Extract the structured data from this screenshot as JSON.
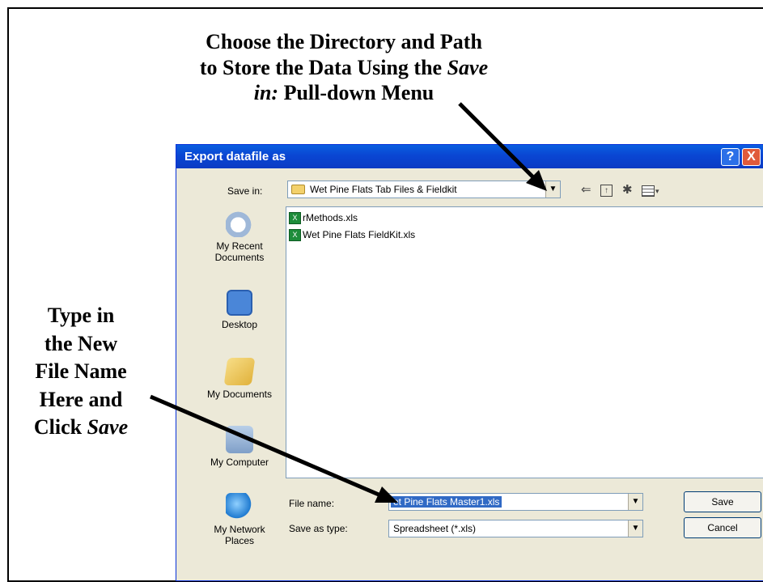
{
  "annotations": {
    "top_line1": "Choose the Directory and Path",
    "top_line2a": "to Store the Data Using the ",
    "top_line2b": "Save",
    "top_line3a": "in:",
    "top_line3b": " Pull-down Menu",
    "left_line1": "Type in",
    "left_line2": "the New",
    "left_line3": "File Name",
    "left_line4": "Here and",
    "left_line5a": "Click ",
    "left_line5b": "Save"
  },
  "dialog": {
    "title": "Export datafile as",
    "help_label": "?",
    "close_label": "X",
    "save_in_label": "Save in:",
    "save_in_value": "Wet Pine Flats Tab Files & Fieldkit",
    "icons": [
      "back-icon",
      "up-folder-icon",
      "new-folder-icon",
      "views-menu-icon"
    ],
    "places": [
      {
        "label_line1": "My Recent",
        "label_line2": "Documents"
      },
      {
        "label_line1": "Desktop",
        "label_line2": ""
      },
      {
        "label_line1": "My Documents",
        "label_line2": ""
      },
      {
        "label_line1": "My Computer",
        "label_line2": ""
      },
      {
        "label_line1": "My Network",
        "label_line2": "Places"
      }
    ],
    "files": [
      "rMethods.xls",
      "Wet Pine Flats FieldKit.xls"
    ],
    "file_name_label": "File name:",
    "file_name_value": "et Pine Flats Master1.xls",
    "save_as_type_label": "Save as type:",
    "save_as_type_value": "Spreadsheet (*.xls)",
    "save_button": "Save",
    "cancel_button": "Cancel"
  },
  "colors": {
    "titlebar": "#0a46d3",
    "dialog_bg": "#ece9d8",
    "selection": "#316ac5"
  }
}
